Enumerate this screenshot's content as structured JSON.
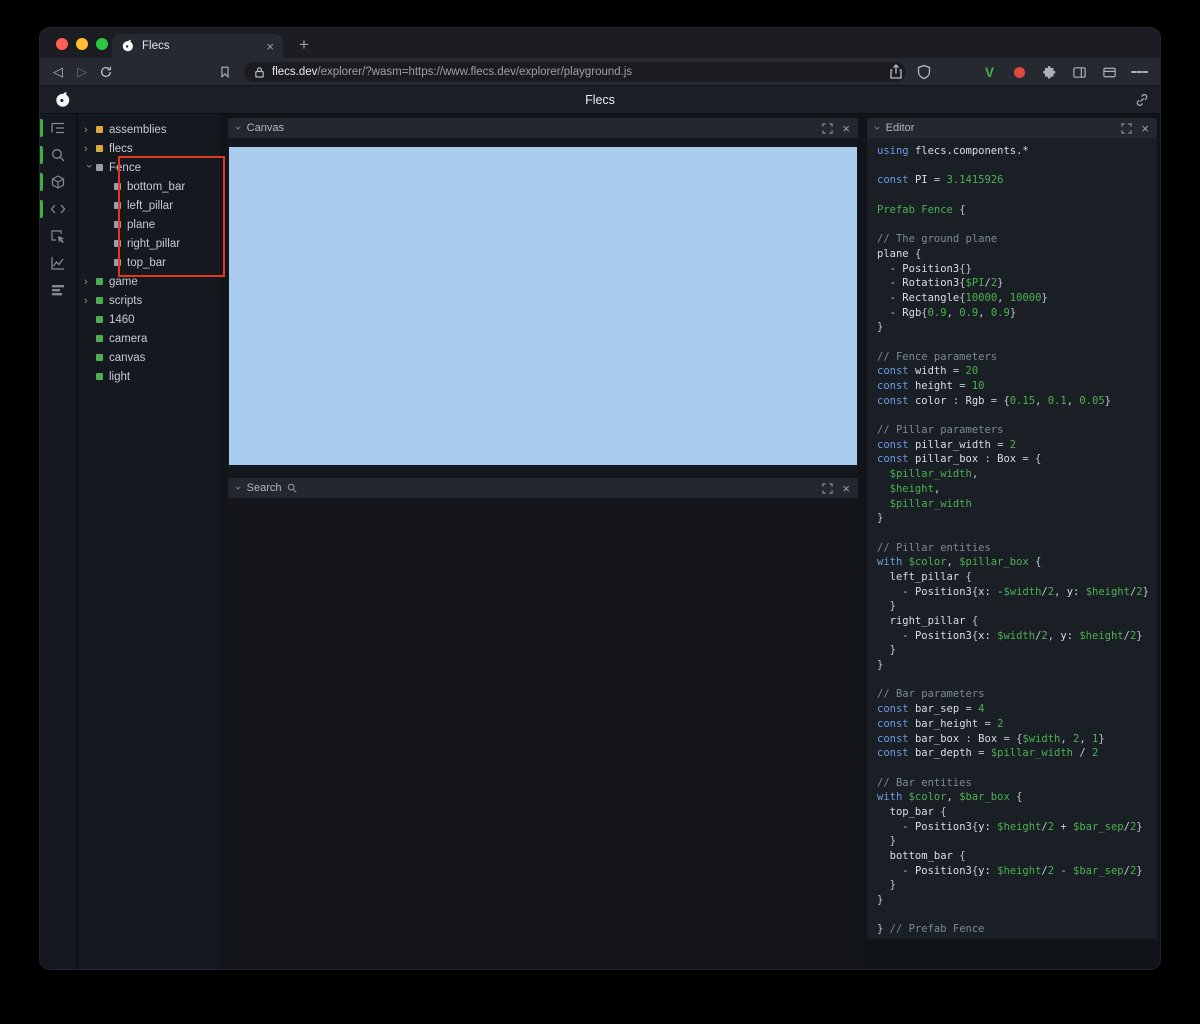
{
  "browser": {
    "tab_title": "Flecs",
    "url_domain": "flecs.dev",
    "url_path": "/explorer/?wasm=https://www.flecs.dev/explorer/playground.js",
    "glyphs": {
      "close": "×",
      "new_tab": "+",
      "vimium_badge": "V"
    },
    "traffic_lights": [
      "#ff5f57",
      "#febc2e",
      "#28c840"
    ]
  },
  "app": {
    "title": "Flecs"
  },
  "sidebar": {
    "icons": [
      {
        "name": "entity-tree",
        "active": true
      },
      {
        "name": "search",
        "active": true
      },
      {
        "name": "cube",
        "active": true
      },
      {
        "name": "code",
        "active": true
      },
      {
        "name": "inspect",
        "active": false
      },
      {
        "name": "chart",
        "active": false
      },
      {
        "name": "stats",
        "active": false
      }
    ]
  },
  "tree": {
    "items": [
      {
        "label": "assemblies",
        "chevron": "right",
        "color": "yellow",
        "depth": 0
      },
      {
        "label": "flecs",
        "chevron": "right",
        "color": "yellow",
        "depth": 0
      },
      {
        "label": "Fence",
        "chevron": "down",
        "color": "gray",
        "depth": 0
      },
      {
        "label": "bottom_bar",
        "chevron": "none",
        "color": "gray",
        "depth": 1
      },
      {
        "label": "left_pillar",
        "chevron": "none",
        "color": "gray",
        "depth": 1
      },
      {
        "label": "plane",
        "chevron": "none",
        "color": "gray",
        "depth": 1
      },
      {
        "label": "right_pillar",
        "chevron": "none",
        "color": "gray",
        "depth": 1
      },
      {
        "label": "top_bar",
        "chevron": "none",
        "color": "gray",
        "depth": 1
      },
      {
        "label": "game",
        "chevron": "right",
        "color": "green",
        "depth": 0
      },
      {
        "label": "scripts",
        "chevron": "right",
        "color": "green",
        "depth": 0
      },
      {
        "label": "1460",
        "chevron": "none",
        "color": "green",
        "depth": 0
      },
      {
        "label": "camera",
        "chevron": "none",
        "color": "green",
        "depth": 0
      },
      {
        "label": "canvas",
        "chevron": "none",
        "color": "green",
        "depth": 0
      },
      {
        "label": "light",
        "chevron": "none",
        "color": "green",
        "depth": 0
      }
    ],
    "annotation": {
      "shape": "red-box",
      "color": "#df3a20",
      "around": "Fence subtree"
    }
  },
  "panels": {
    "canvas": "Canvas",
    "search": "Search",
    "editor": "Editor"
  },
  "colors": {
    "canvas_viewport": "#a9cbee",
    "accent_green": "#3fae49",
    "node_yellow": "#d9a83e",
    "node_green": "#4fae54",
    "node_gray": "#98a1ab",
    "code_keyword": "#6e9ae6",
    "code_number": "#4cb04f",
    "code_comment": "#7e8893"
  },
  "editor_lines": [
    [
      [
        "k",
        "using "
      ],
      [
        "i",
        "flecs.components.*"
      ]
    ],
    [],
    [
      [
        "k",
        "const "
      ],
      [
        "i",
        "PI"
      ],
      [
        "p",
        " = "
      ],
      [
        "n",
        "3.1415926"
      ]
    ],
    [],
    [
      [
        "g",
        "Prefab Fence "
      ],
      [
        "p",
        "{"
      ]
    ],
    [],
    [
      [
        "c",
        "// The ground plane"
      ]
    ],
    [
      [
        "i",
        "plane "
      ],
      [
        "p",
        "{"
      ]
    ],
    [
      [
        "p",
        "  - "
      ],
      [
        "i",
        "Position3"
      ],
      [
        "p",
        "{}"
      ]
    ],
    [
      [
        "p",
        "  - "
      ],
      [
        "i",
        "Rotation3"
      ],
      [
        "p",
        "{"
      ],
      [
        "v",
        "$PI"
      ],
      [
        "p",
        "/"
      ],
      [
        "n",
        "2"
      ],
      [
        "p",
        "}"
      ]
    ],
    [
      [
        "p",
        "  - "
      ],
      [
        "i",
        "Rectangle"
      ],
      [
        "p",
        "{"
      ],
      [
        "n",
        "10000"
      ],
      [
        "p",
        ", "
      ],
      [
        "n",
        "10000"
      ],
      [
        "p",
        "}"
      ]
    ],
    [
      [
        "p",
        "  - "
      ],
      [
        "i",
        "Rgb"
      ],
      [
        "p",
        "{"
      ],
      [
        "n",
        "0.9"
      ],
      [
        "p",
        ", "
      ],
      [
        "n",
        "0.9"
      ],
      [
        "p",
        ", "
      ],
      [
        "n",
        "0.9"
      ],
      [
        "p",
        "}"
      ]
    ],
    [
      [
        "p",
        "}"
      ]
    ],
    [],
    [
      [
        "c",
        "// Fence parameters"
      ]
    ],
    [
      [
        "k",
        "const "
      ],
      [
        "i",
        "width"
      ],
      [
        "p",
        " = "
      ],
      [
        "n",
        "20"
      ]
    ],
    [
      [
        "k",
        "const "
      ],
      [
        "i",
        "height"
      ],
      [
        "p",
        " = "
      ],
      [
        "n",
        "10"
      ]
    ],
    [
      [
        "k",
        "const "
      ],
      [
        "i",
        "color"
      ],
      [
        "p",
        " : "
      ],
      [
        "i",
        "Rgb"
      ],
      [
        "p",
        " = {"
      ],
      [
        "n",
        "0.15"
      ],
      [
        "p",
        ", "
      ],
      [
        "n",
        "0.1"
      ],
      [
        "p",
        ", "
      ],
      [
        "n",
        "0.05"
      ],
      [
        "p",
        "}"
      ]
    ],
    [],
    [
      [
        "c",
        "// Pillar parameters"
      ]
    ],
    [
      [
        "k",
        "const "
      ],
      [
        "i",
        "pillar_width"
      ],
      [
        "p",
        " = "
      ],
      [
        "n",
        "2"
      ]
    ],
    [
      [
        "k",
        "const "
      ],
      [
        "i",
        "pillar_box"
      ],
      [
        "p",
        " : "
      ],
      [
        "i",
        "Box"
      ],
      [
        "p",
        " = {"
      ]
    ],
    [
      [
        "v",
        "  $pillar_width"
      ],
      [
        "p",
        ","
      ]
    ],
    [
      [
        "v",
        "  $height"
      ],
      [
        "p",
        ","
      ]
    ],
    [
      [
        "v",
        "  $pillar_width"
      ]
    ],
    [
      [
        "p",
        "}"
      ]
    ],
    [],
    [
      [
        "c",
        "// Pillar entities"
      ]
    ],
    [
      [
        "k",
        "with "
      ],
      [
        "v",
        "$color"
      ],
      [
        "p",
        ", "
      ],
      [
        "v",
        "$pillar_box"
      ],
      [
        "p",
        " {"
      ]
    ],
    [
      [
        "i",
        "  left_pillar "
      ],
      [
        "p",
        "{"
      ]
    ],
    [
      [
        "p",
        "    - "
      ],
      [
        "i",
        "Position3"
      ],
      [
        "p",
        "{"
      ],
      [
        "i",
        "x: "
      ],
      [
        "p",
        "-"
      ],
      [
        "v",
        "$width"
      ],
      [
        "p",
        "/"
      ],
      [
        "n",
        "2"
      ],
      [
        "p",
        ", "
      ],
      [
        "i",
        "y: "
      ],
      [
        "v",
        "$height"
      ],
      [
        "p",
        "/"
      ],
      [
        "n",
        "2"
      ],
      [
        "p",
        "}"
      ]
    ],
    [
      [
        "p",
        "  }"
      ]
    ],
    [
      [
        "i",
        "  right_pillar "
      ],
      [
        "p",
        "{"
      ]
    ],
    [
      [
        "p",
        "    - "
      ],
      [
        "i",
        "Position3"
      ],
      [
        "p",
        "{"
      ],
      [
        "i",
        "x: "
      ],
      [
        "v",
        "$width"
      ],
      [
        "p",
        "/"
      ],
      [
        "n",
        "2"
      ],
      [
        "p",
        ", "
      ],
      [
        "i",
        "y: "
      ],
      [
        "v",
        "$height"
      ],
      [
        "p",
        "/"
      ],
      [
        "n",
        "2"
      ],
      [
        "p",
        "}"
      ]
    ],
    [
      [
        "p",
        "  }"
      ]
    ],
    [
      [
        "p",
        "}"
      ]
    ],
    [],
    [
      [
        "c",
        "// Bar parameters"
      ]
    ],
    [
      [
        "k",
        "const "
      ],
      [
        "i",
        "bar_sep"
      ],
      [
        "p",
        " = "
      ],
      [
        "n",
        "4"
      ]
    ],
    [
      [
        "k",
        "const "
      ],
      [
        "i",
        "bar_height"
      ],
      [
        "p",
        " = "
      ],
      [
        "n",
        "2"
      ]
    ],
    [
      [
        "k",
        "const "
      ],
      [
        "i",
        "bar_box"
      ],
      [
        "p",
        " : "
      ],
      [
        "i",
        "Box"
      ],
      [
        "p",
        " = {"
      ],
      [
        "v",
        "$width"
      ],
      [
        "p",
        ", "
      ],
      [
        "n",
        "2"
      ],
      [
        "p",
        ", "
      ],
      [
        "n",
        "1"
      ],
      [
        "p",
        "}"
      ]
    ],
    [
      [
        "k",
        "const "
      ],
      [
        "i",
        "bar_depth"
      ],
      [
        "p",
        " = "
      ],
      [
        "v",
        "$pillar_width"
      ],
      [
        "p",
        " / "
      ],
      [
        "n",
        "2"
      ]
    ],
    [],
    [
      [
        "c",
        "// Bar entities"
      ]
    ],
    [
      [
        "k",
        "with "
      ],
      [
        "v",
        "$color"
      ],
      [
        "p",
        ", "
      ],
      [
        "v",
        "$bar_box"
      ],
      [
        "p",
        " {"
      ]
    ],
    [
      [
        "i",
        "  top_bar "
      ],
      [
        "p",
        "{"
      ]
    ],
    [
      [
        "p",
        "    - "
      ],
      [
        "i",
        "Position3"
      ],
      [
        "p",
        "{"
      ],
      [
        "i",
        "y: "
      ],
      [
        "v",
        "$height"
      ],
      [
        "p",
        "/"
      ],
      [
        "n",
        "2"
      ],
      [
        "p",
        " + "
      ],
      [
        "v",
        "$bar_sep"
      ],
      [
        "p",
        "/"
      ],
      [
        "n",
        "2"
      ],
      [
        "p",
        "}"
      ]
    ],
    [
      [
        "p",
        "  }"
      ]
    ],
    [
      [
        "i",
        "  bottom_bar "
      ],
      [
        "p",
        "{"
      ]
    ],
    [
      [
        "p",
        "    - "
      ],
      [
        "i",
        "Position3"
      ],
      [
        "p",
        "{"
      ],
      [
        "i",
        "y: "
      ],
      [
        "v",
        "$height"
      ],
      [
        "p",
        "/"
      ],
      [
        "n",
        "2"
      ],
      [
        "p",
        " - "
      ],
      [
        "v",
        "$bar_sep"
      ],
      [
        "p",
        "/"
      ],
      [
        "n",
        "2"
      ],
      [
        "p",
        "}"
      ]
    ],
    [
      [
        "p",
        "  }"
      ]
    ],
    [
      [
        "p",
        "}"
      ]
    ],
    [],
    [
      [
        "p",
        "} "
      ],
      [
        "c",
        "// Prefab Fence"
      ]
    ]
  ]
}
